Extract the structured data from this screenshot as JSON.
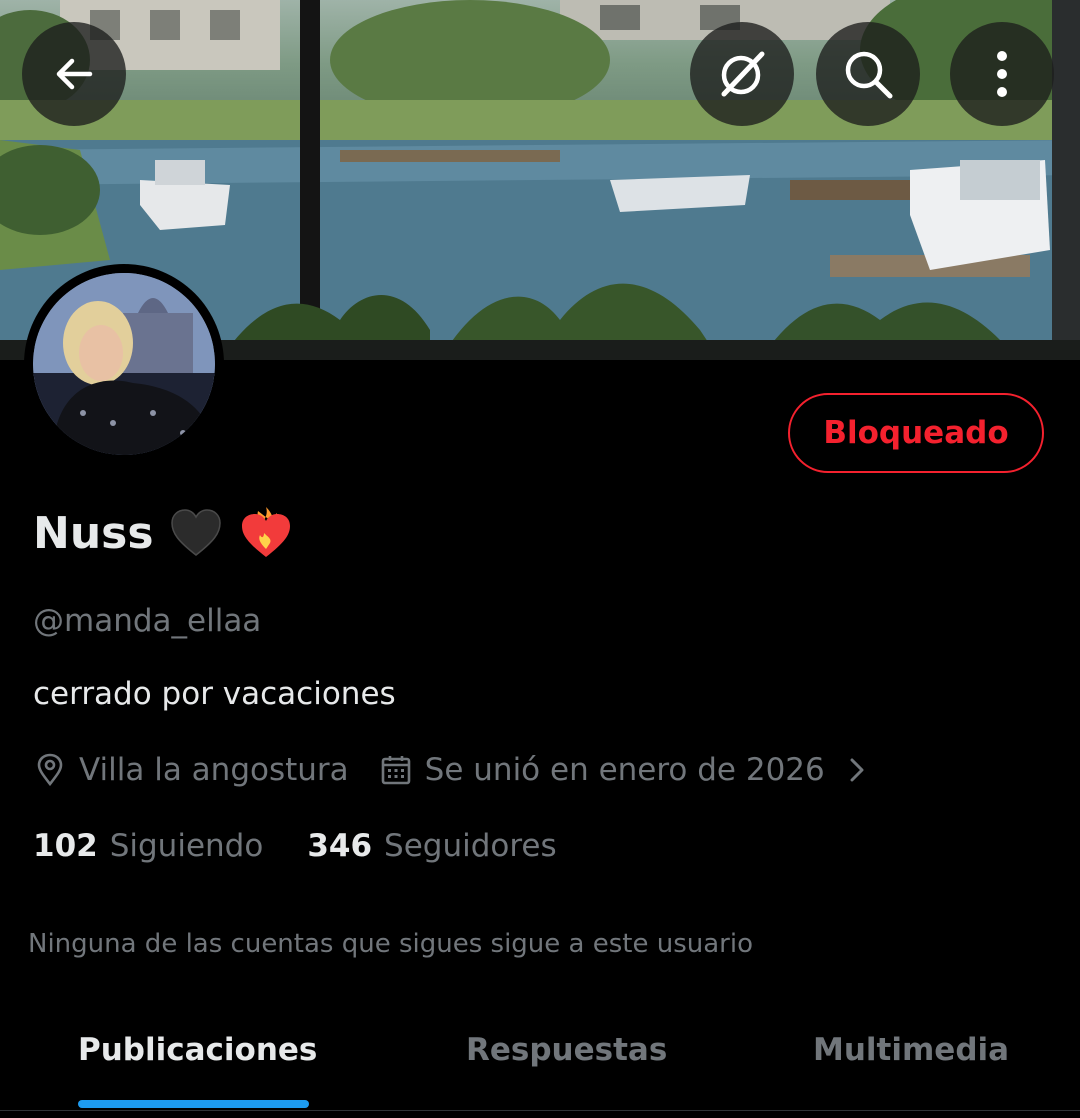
{
  "header": {
    "back_icon": "arrow-left-icon",
    "grok_icon": "grok-slash-icon",
    "search_icon": "search-icon",
    "more_icon": "more-vertical-icon"
  },
  "profile": {
    "display_name": "Nuss",
    "name_emojis": [
      "black-heart-emoji",
      "heart-on-fire-emoji"
    ],
    "handle": "@manda_ellaa",
    "bio": "cerrado por vacaciones",
    "location": "Villa la angostura",
    "joined": "Se unió en enero de 2026",
    "following_count": "102",
    "following_label": "Siguiendo",
    "followers_count": "346",
    "followers_label": "Seguidores",
    "mutuals_note": "Ninguna de las cuentas que sigues sigue a este usuario"
  },
  "actions": {
    "blocked_label": "Bloqueado"
  },
  "tabs": [
    {
      "label": "Publicaciones",
      "active": true
    },
    {
      "label": "Respuestas",
      "active": false
    },
    {
      "label": "Multimedia",
      "active": false
    }
  ],
  "colors": {
    "accent": "#1d9bf0",
    "blocked": "#f4212e",
    "muted_text": "#71767b",
    "primary_text": "#e7e9ea",
    "background": "#000000"
  }
}
